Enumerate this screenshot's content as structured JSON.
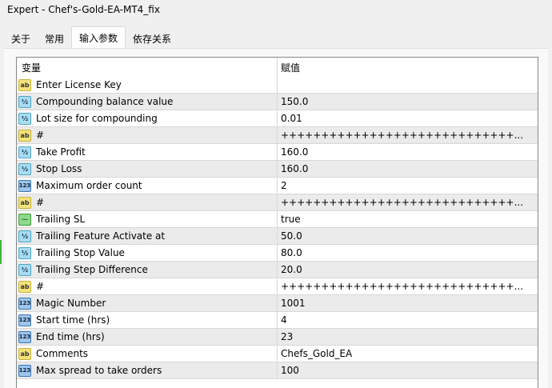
{
  "window": {
    "title": "Expert - Chef's-Gold-EA-MT4_fix"
  },
  "tabs": [
    {
      "label": "关于"
    },
    {
      "label": "常用"
    },
    {
      "label": "输入参数",
      "active": true
    },
    {
      "label": "依存关系"
    }
  ],
  "table": {
    "headers": {
      "variable": "变量",
      "value": "赋值"
    },
    "rows": [
      {
        "type": "ab",
        "name": "Enter License Key",
        "value": ""
      },
      {
        "type": "dbl",
        "name": "Compounding balance value",
        "value": "150.0"
      },
      {
        "type": "dbl",
        "name": "Lot size for compounding",
        "value": "0.01"
      },
      {
        "type": "ab",
        "name": "#",
        "value": "+++++++++++++++++++++++++++++..."
      },
      {
        "type": "dbl",
        "name": "Take Profit",
        "value": "160.0"
      },
      {
        "type": "dbl",
        "name": "Stop Loss",
        "value": "160.0"
      },
      {
        "type": "int",
        "name": "Maximum order count",
        "value": "2"
      },
      {
        "type": "ab",
        "name": "#",
        "value": "+++++++++++++++++++++++++++++..."
      },
      {
        "type": "bool",
        "name": "Trailing SL",
        "value": "true"
      },
      {
        "type": "dbl",
        "name": "Trailing Feature Activate at",
        "value": "50.0"
      },
      {
        "type": "dbl",
        "name": "Trailing Stop Value",
        "value": "80.0"
      },
      {
        "type": "dbl",
        "name": "Trailing Step Difference",
        "value": "20.0"
      },
      {
        "type": "ab",
        "name": "#",
        "value": "+++++++++++++++++++++++++++++..."
      },
      {
        "type": "int",
        "name": "Magic Number",
        "value": "1001"
      },
      {
        "type": "int",
        "name": "Start time (hrs)",
        "value": "4"
      },
      {
        "type": "int",
        "name": "End time (hrs)",
        "value": "23"
      },
      {
        "type": "ab",
        "name": "Comments",
        "value": "Chefs_Gold_EA"
      },
      {
        "type": "int",
        "name": "Max spread to take orders",
        "value": "100"
      }
    ]
  },
  "icons": {
    "ab": "ab",
    "dbl": "½",
    "int": "123",
    "bool": "⁓"
  }
}
